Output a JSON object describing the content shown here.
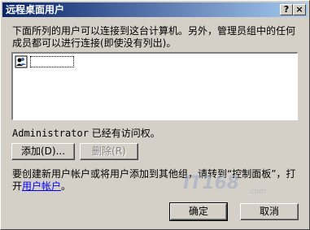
{
  "window": {
    "title": "远程桌面用户",
    "help_button": "?",
    "close_button": "×"
  },
  "intro_text": "下面所列的用户可以连接到这台计算机。另外，管理员组中的任何成员都可以进行连接(即使没有列出)。",
  "user_list": {
    "items": [
      {
        "label": "",
        "icon": "user-icon"
      }
    ]
  },
  "status": {
    "account": "Administrator",
    "message": " 已经有访问权。"
  },
  "buttons": {
    "add": "添加(D)...",
    "remove": "删除(R)",
    "ok": "确定",
    "cancel": "取消"
  },
  "info": {
    "text": "要创建新用户帐户或将用户添加到其他组，请转到“控制面板”，打开",
    "link": "用户帐户",
    "suffix": "。"
  },
  "watermark": {
    "text": "IT168",
    "sub": ".com"
  },
  "colors": {
    "title_start": "#0a246a",
    "title_end": "#a6caf0",
    "dialog_bg": "#d4d0c8",
    "link": "#0000ff"
  }
}
